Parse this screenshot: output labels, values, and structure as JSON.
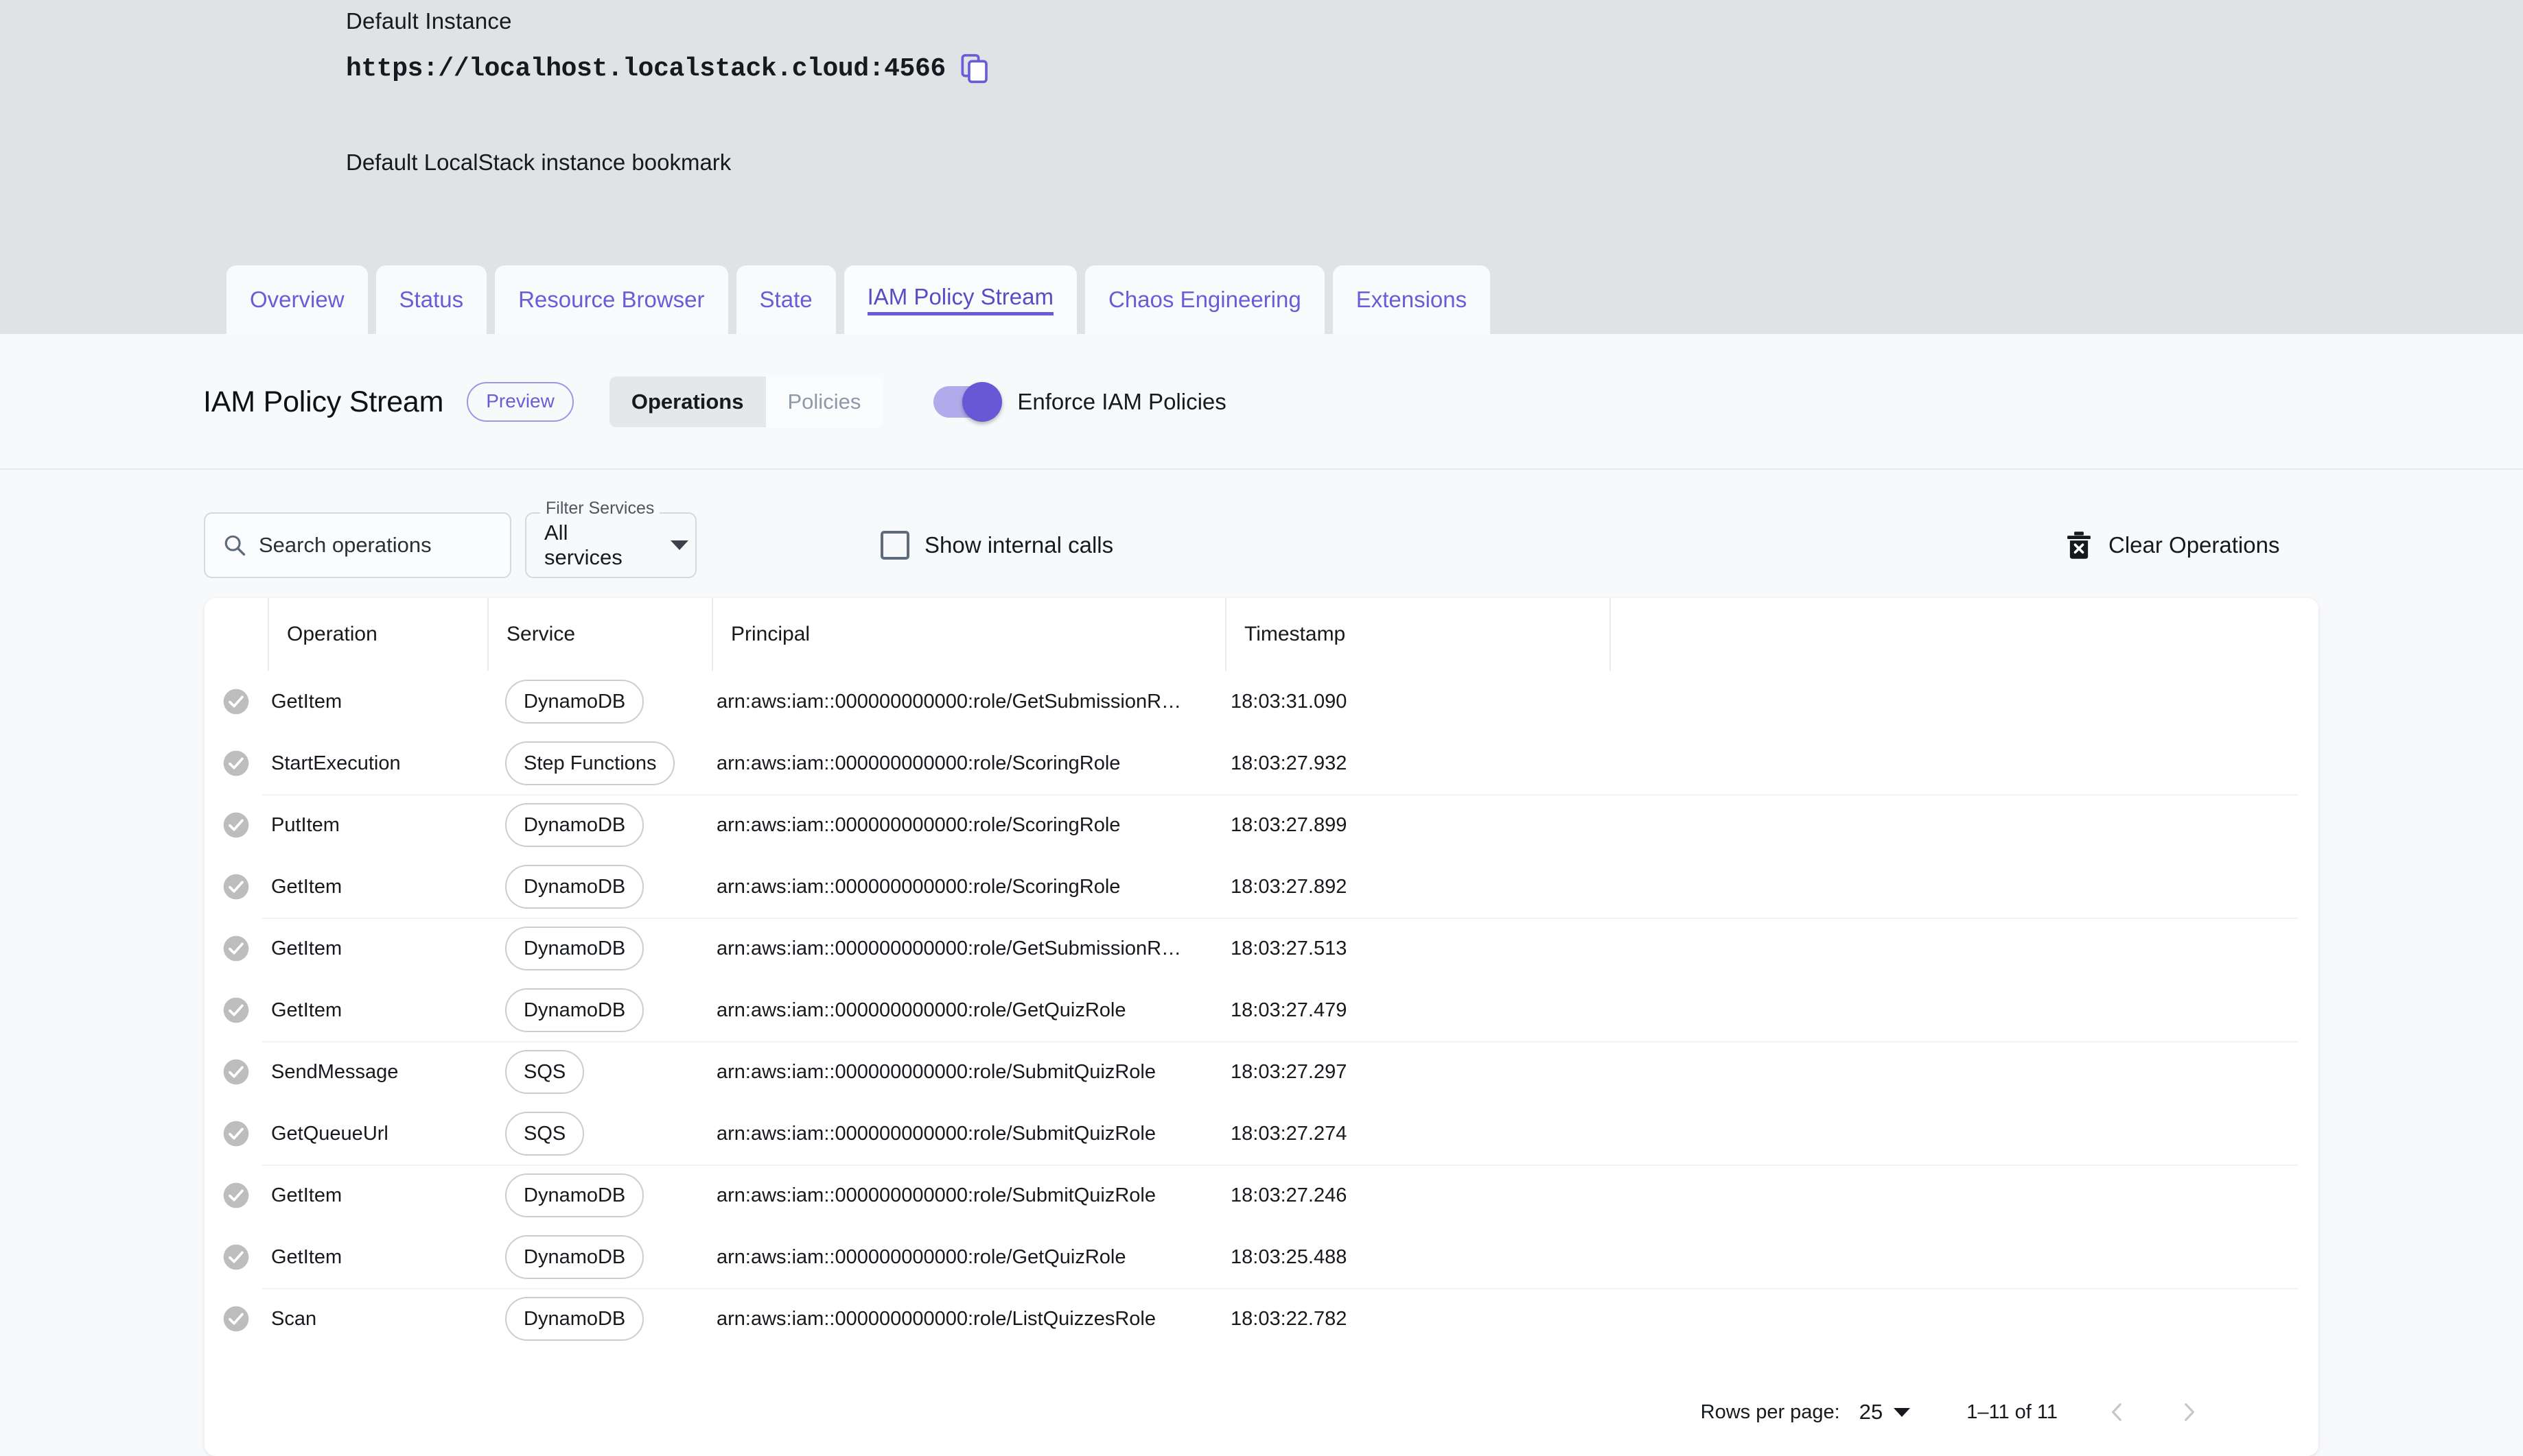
{
  "instance": {
    "title": "Default Instance",
    "url": "https://localhost.localstack.cloud:4566",
    "copy_icon": "copy-icon",
    "subtitle": "Default LocalStack instance bookmark"
  },
  "tabs": [
    {
      "label": "Overview",
      "active": false
    },
    {
      "label": "Status",
      "active": false
    },
    {
      "label": "Resource Browser",
      "active": false
    },
    {
      "label": "State",
      "active": false
    },
    {
      "label": "IAM Policy Stream",
      "active": true
    },
    {
      "label": "Chaos Engineering",
      "active": false
    },
    {
      "label": "Extensions",
      "active": false
    }
  ],
  "page_header": {
    "title": "IAM Policy Stream",
    "preview_badge": "Preview",
    "segments": [
      {
        "label": "Operations",
        "selected": true
      },
      {
        "label": "Policies",
        "selected": false
      }
    ],
    "toggle": {
      "label": "Enforce IAM Policies",
      "on": true,
      "track_color": "#b3aaec",
      "knob_color": "#6a57d5"
    }
  },
  "filters": {
    "search_placeholder": "Search operations",
    "search_value": "",
    "search_icon": "search-icon",
    "service_filter_legend": "Filter Services",
    "service_filter_value": "All services",
    "service_filter_options": [
      "All services"
    ],
    "show_internal_calls_label": "Show internal calls",
    "show_internal_calls_checked": false,
    "clear_operations_label": "Clear Operations",
    "clear_operations_icon": "trash-icon"
  },
  "table": {
    "columns": [
      "Operation",
      "Service",
      "Principal",
      "Timestamp"
    ],
    "rows": [
      {
        "status": "allowed",
        "operation": "GetItem",
        "service": "DynamoDB",
        "principal": "arn:aws:iam::000000000000:role/GetSubmissionR…",
        "timestamp": "18:03:31.090"
      },
      {
        "status": "allowed",
        "operation": "StartExecution",
        "service": "Step Functions",
        "principal": "arn:aws:iam::000000000000:role/ScoringRole",
        "timestamp": "18:03:27.932"
      },
      {
        "status": "allowed",
        "operation": "PutItem",
        "service": "DynamoDB",
        "principal": "arn:aws:iam::000000000000:role/ScoringRole",
        "timestamp": "18:03:27.899"
      },
      {
        "status": "allowed",
        "operation": "GetItem",
        "service": "DynamoDB",
        "principal": "arn:aws:iam::000000000000:role/ScoringRole",
        "timestamp": "18:03:27.892"
      },
      {
        "status": "allowed",
        "operation": "GetItem",
        "service": "DynamoDB",
        "principal": "arn:aws:iam::000000000000:role/GetSubmissionR…",
        "timestamp": "18:03:27.513"
      },
      {
        "status": "allowed",
        "operation": "GetItem",
        "service": "DynamoDB",
        "principal": "arn:aws:iam::000000000000:role/GetQuizRole",
        "timestamp": "18:03:27.479"
      },
      {
        "status": "allowed",
        "operation": "SendMessage",
        "service": "SQS",
        "principal": "arn:aws:iam::000000000000:role/SubmitQuizRole",
        "timestamp": "18:03:27.297"
      },
      {
        "status": "allowed",
        "operation": "GetQueueUrl",
        "service": "SQS",
        "principal": "arn:aws:iam::000000000000:role/SubmitQuizRole",
        "timestamp": "18:03:27.274"
      },
      {
        "status": "allowed",
        "operation": "GetItem",
        "service": "DynamoDB",
        "principal": "arn:aws:iam::000000000000:role/SubmitQuizRole",
        "timestamp": "18:03:27.246"
      },
      {
        "status": "allowed",
        "operation": "GetItem",
        "service": "DynamoDB",
        "principal": "arn:aws:iam::000000000000:role/GetQuizRole",
        "timestamp": "18:03:25.488"
      },
      {
        "status": "allowed",
        "operation": "Scan",
        "service": "DynamoDB",
        "principal": "arn:aws:iam::000000000000:role/ListQuizzesRole",
        "timestamp": "18:03:22.782"
      }
    ]
  },
  "pagination": {
    "rows_per_page_label": "Rows per page:",
    "rows_per_page_value": "25",
    "range_label": "1–11 of 11",
    "prev_icon": "chevron-left-icon",
    "next_icon": "chevron-right-icon"
  },
  "colors": {
    "accent": "#6a5cd6",
    "header_bg": "#dfe3e6",
    "page_bg": "#f8f9fb",
    "card_bg": "#ffffff",
    "status_icon": "#bdbdbd"
  }
}
